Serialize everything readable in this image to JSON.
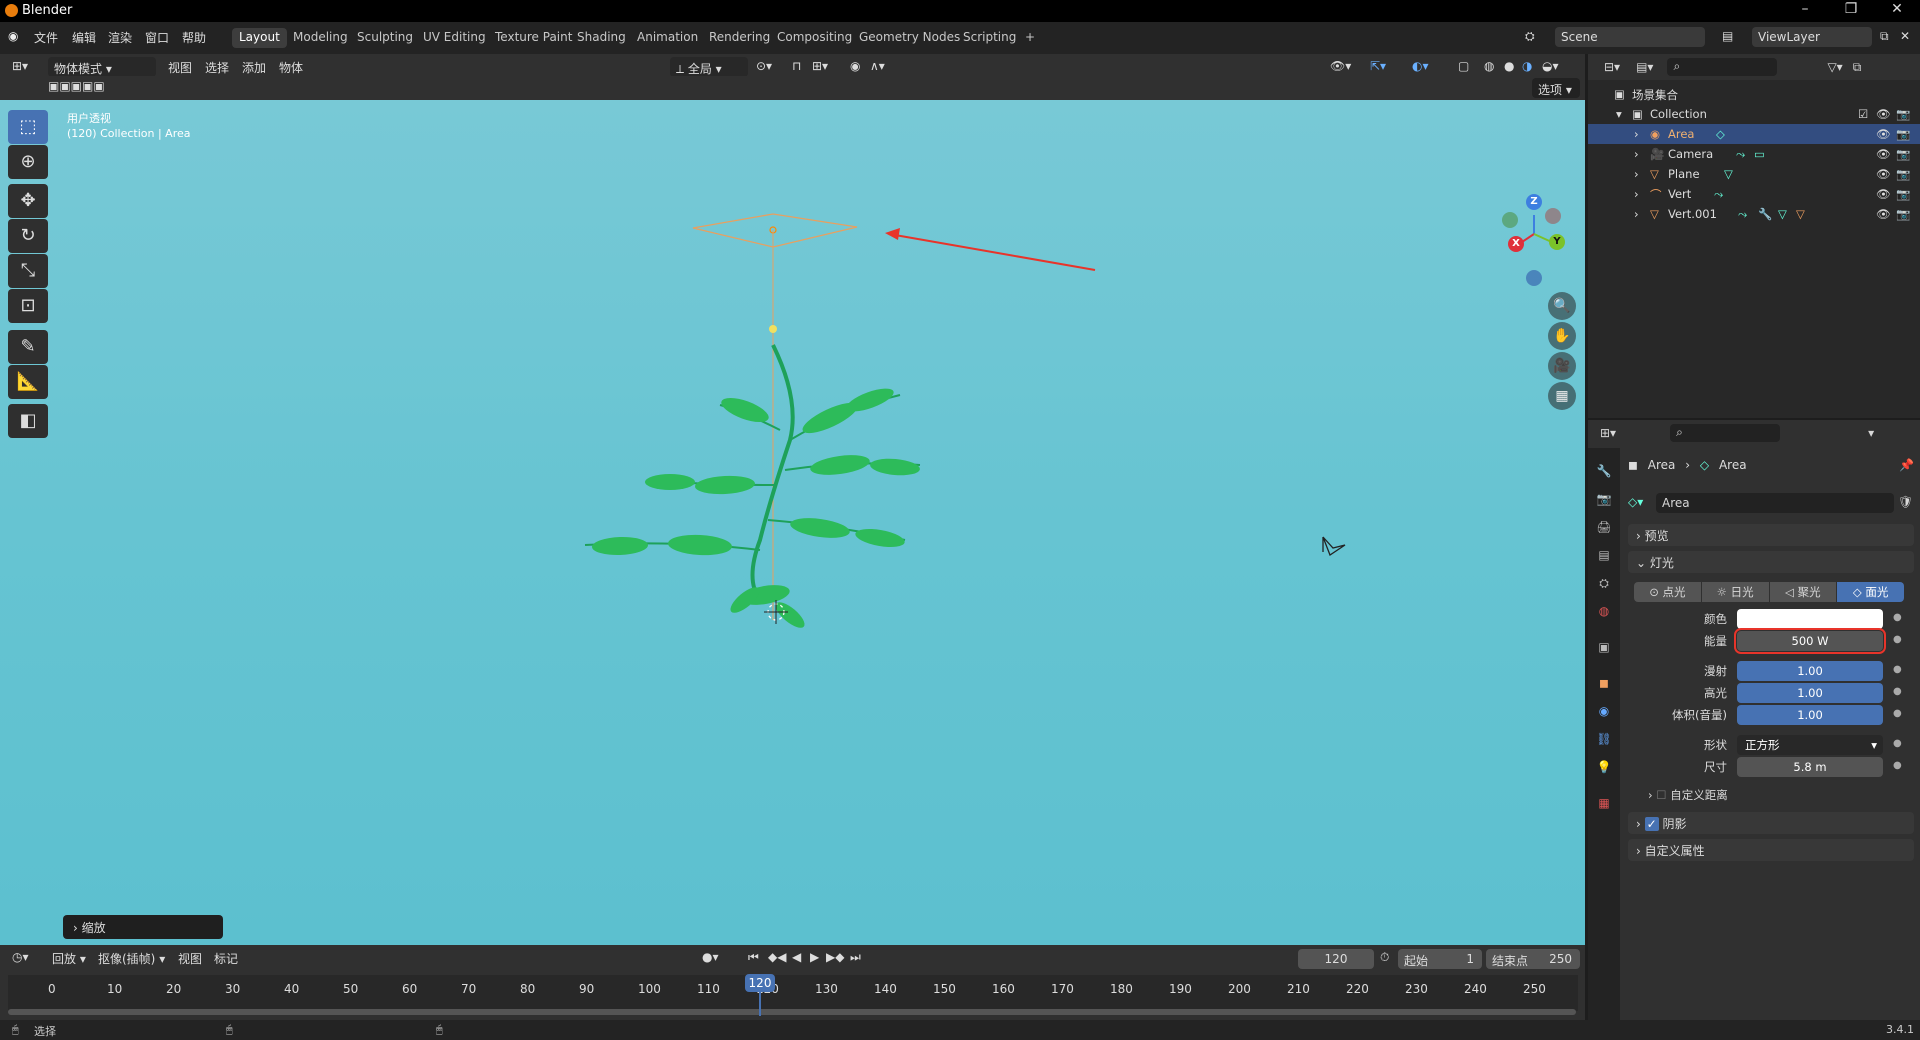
{
  "app": {
    "title": "Blender",
    "version": "3.4.1"
  },
  "menu": [
    "文件",
    "编辑",
    "渲染",
    "窗口",
    "帮助"
  ],
  "workspaces": [
    "Layout",
    "Modeling",
    "Sculpting",
    "UV Editing",
    "Texture Paint",
    "Shading",
    "Animation",
    "Rendering",
    "Compositing",
    "Geometry Nodes",
    "Scripting",
    "+"
  ],
  "scene": {
    "name": "Scene",
    "view_layer": "ViewLayer"
  },
  "viewport_header": {
    "mode": "物体模式",
    "menus": [
      "视图",
      "选择",
      "添加",
      "物体"
    ],
    "transform": "全局",
    "options": "选项"
  },
  "viewport": {
    "view_name": "用户透视",
    "collection_info": "(120) Collection | Area",
    "operator_panel": "缩放",
    "gizmo": {
      "z": "Z",
      "x": "X",
      "y": "Y"
    }
  },
  "outliner": {
    "root": "场景集合",
    "collection": "Collection",
    "items": [
      "Area",
      "Camera",
      "Plane",
      "Vert",
      "Vert.001"
    ]
  },
  "properties": {
    "breadcrumb_obj": "Area",
    "breadcrumb_data": "Area",
    "data_name": "Area",
    "panels": {
      "preview": "预览",
      "light": "灯光",
      "custom_distance": "自定义距离",
      "shadow": "阴影",
      "custom_props": "自定义属性"
    },
    "light_types": [
      "点光",
      "日光",
      "聚光",
      "面光"
    ],
    "fields": {
      "color_label": "颜色",
      "energy_label": "能量",
      "energy": "500 W",
      "diffuse_label": "漫射",
      "diffuse": "1.00",
      "specular_label": "高光",
      "specular": "1.00",
      "volume_label": "体积(音量)",
      "volume": "1.00",
      "shape_label": "形状",
      "shape": "正方形",
      "size_label": "尺寸",
      "size": "5.8 m"
    }
  },
  "timeline": {
    "menus": [
      "回放",
      "抠像(插帧)",
      "视图",
      "标记"
    ],
    "current_frame": "120",
    "start_label": "起始",
    "start": "1",
    "end_label": "结束点",
    "end": "250",
    "ticks": [
      "0",
      "10",
      "20",
      "30",
      "40",
      "50",
      "60",
      "70",
      "80",
      "90",
      "100",
      "110",
      "120",
      "130",
      "140",
      "150",
      "160",
      "170",
      "180",
      "190",
      "200",
      "210",
      "220",
      "230",
      "240",
      "250"
    ]
  },
  "status": {
    "select": "选择"
  }
}
